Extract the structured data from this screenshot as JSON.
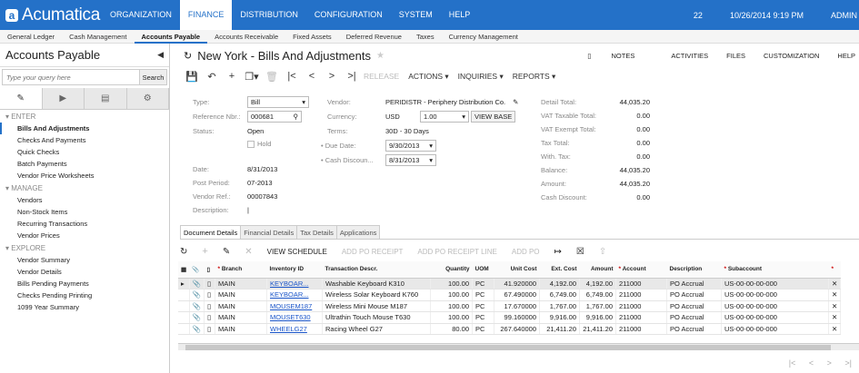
{
  "app": {
    "logo_text": "Acumatica",
    "modules": [
      "ORGANIZATION",
      "FINANCE",
      "DISTRIBUTION",
      "CONFIGURATION",
      "SYSTEM",
      "HELP"
    ],
    "active_module": 1,
    "notifications_count": "22",
    "datetime": "10/26/2014 9:19 PM",
    "user": "ADMIN"
  },
  "subnav": [
    "General Ledger",
    "Cash Management",
    "Accounts Payable",
    "Accounts Receivable",
    "Fixed Assets",
    "Deferred Revenue",
    "Taxes",
    "Currency Management"
  ],
  "left": {
    "title": "Accounts Payable",
    "search_placeholder": "Type your query here",
    "search_button": "Search",
    "sections": [
      {
        "name": "ENTER",
        "items": [
          "Bills And Adjustments",
          "Checks And Payments",
          "Quick Checks",
          "Batch Payments",
          "Vendor Price Worksheets"
        ]
      },
      {
        "name": "MANAGE",
        "items": [
          "Vendors",
          "Non-Stock Items",
          "Recurring Transactions",
          "Vendor Prices"
        ]
      },
      {
        "name": "EXPLORE",
        "items": [
          "Vendor Summary",
          "Vendor Details",
          "Bills Pending Payments",
          "Checks Pending Printing",
          "1099 Year Summary"
        ]
      }
    ]
  },
  "page": {
    "title": "New York - Bills And Adjustments",
    "actions": [
      "NOTES",
      "ACTIVITIES",
      "FILES",
      "CUSTOMIZATION",
      "HELP"
    ],
    "toolbar": {
      "release": "RELEASE",
      "actions": "ACTIONS",
      "inquiries": "INQUIRIES",
      "reports": "REPORTS"
    }
  },
  "form": {
    "type_label": "Type:",
    "type_value": "Bill",
    "ref_label": "Reference Nbr.:",
    "ref_value": "000681",
    "status_label": "Status:",
    "status_value": "Open",
    "hold_label": "Hold",
    "date_label": "Date:",
    "date_value": "8/31/2013",
    "period_label": "Post Period:",
    "period_value": "07-2013",
    "vendref_label": "Vendor Ref.:",
    "vendref_value": "00007843",
    "desc_label": "Description:",
    "desc_value": "",
    "vendor_label": "Vendor:",
    "vendor_value": "PERIDISTR - Periphery Distribution Co.",
    "currency_label": "Currency:",
    "currency_value": "USD",
    "rate_value": "1.00",
    "view_base": "VIEW BASE",
    "terms_label": "Terms:",
    "terms_value": "30D - 30 Days",
    "due_label": "Due Date:",
    "due_value": "9/30/2013",
    "cashdisc_label": "Cash Discoun...",
    "cashdisc_value": "8/31/2013",
    "totals": [
      {
        "label": "Detail Total:",
        "value": "44,035.20"
      },
      {
        "label": "VAT Taxable Total:",
        "value": "0.00"
      },
      {
        "label": "VAT Exempt Total:",
        "value": "0.00"
      },
      {
        "label": "Tax Total:",
        "value": "0.00"
      },
      {
        "label": "With. Tax:",
        "value": "0.00"
      },
      {
        "label": "Balance:",
        "value": "44,035.20"
      },
      {
        "label": "Amount:",
        "value": "44,035.20"
      },
      {
        "label": "Cash Discount:",
        "value": "0.00"
      }
    ]
  },
  "tabs": [
    "Document Details",
    "Financial Details",
    "Tax Details",
    "Applications"
  ],
  "grid_toolbar": {
    "view_schedule": "VIEW SCHEDULE",
    "add_po_receipt": "ADD PO RECEIPT",
    "add_po_receipt_line": "ADD PO RECEIPT LINE",
    "add_po": "ADD PO"
  },
  "grid": {
    "headers": [
      "Branch",
      "Inventory ID",
      "Transaction Descr.",
      "Quantity",
      "UOM",
      "Unit Cost",
      "Ext. Cost",
      "Amount",
      "Account",
      "Description",
      "Subaccount"
    ],
    "rows": [
      [
        "MAIN",
        "KEYBOAR...",
        "Washable Keyboard K310",
        "100.00",
        "PC",
        "41.920000",
        "4,192.00",
        "4,192.00",
        "211000",
        "PO Accrual",
        "US-00-00-00-000"
      ],
      [
        "MAIN",
        "KEYBOAR...",
        "Wireless Solar Keyboard K760",
        "100.00",
        "PC",
        "67.490000",
        "6,749.00",
        "6,749.00",
        "211000",
        "PO Accrual",
        "US-00-00-00-000"
      ],
      [
        "MAIN",
        "MOUSEM187",
        "Wireless Mini Mouse M187",
        "100.00",
        "PC",
        "17.670000",
        "1,767.00",
        "1,767.00",
        "211000",
        "PO Accrual",
        "US-00-00-00-000"
      ],
      [
        "MAIN",
        "MOUSET630",
        "Ultrathin Touch Mouse T630",
        "100.00",
        "PC",
        "99.160000",
        "9,916.00",
        "9,916.00",
        "211000",
        "PO Accrual",
        "US-00-00-00-000"
      ],
      [
        "MAIN",
        "WHEELG27",
        "Racing Wheel G27",
        "80.00",
        "PC",
        "267.640000",
        "21,411.20",
        "21,411.20",
        "211000",
        "PO Accrual",
        "US-00-00-00-000"
      ]
    ]
  },
  "colors": {
    "brand": "#2471c8",
    "link": "#1a55c9"
  }
}
